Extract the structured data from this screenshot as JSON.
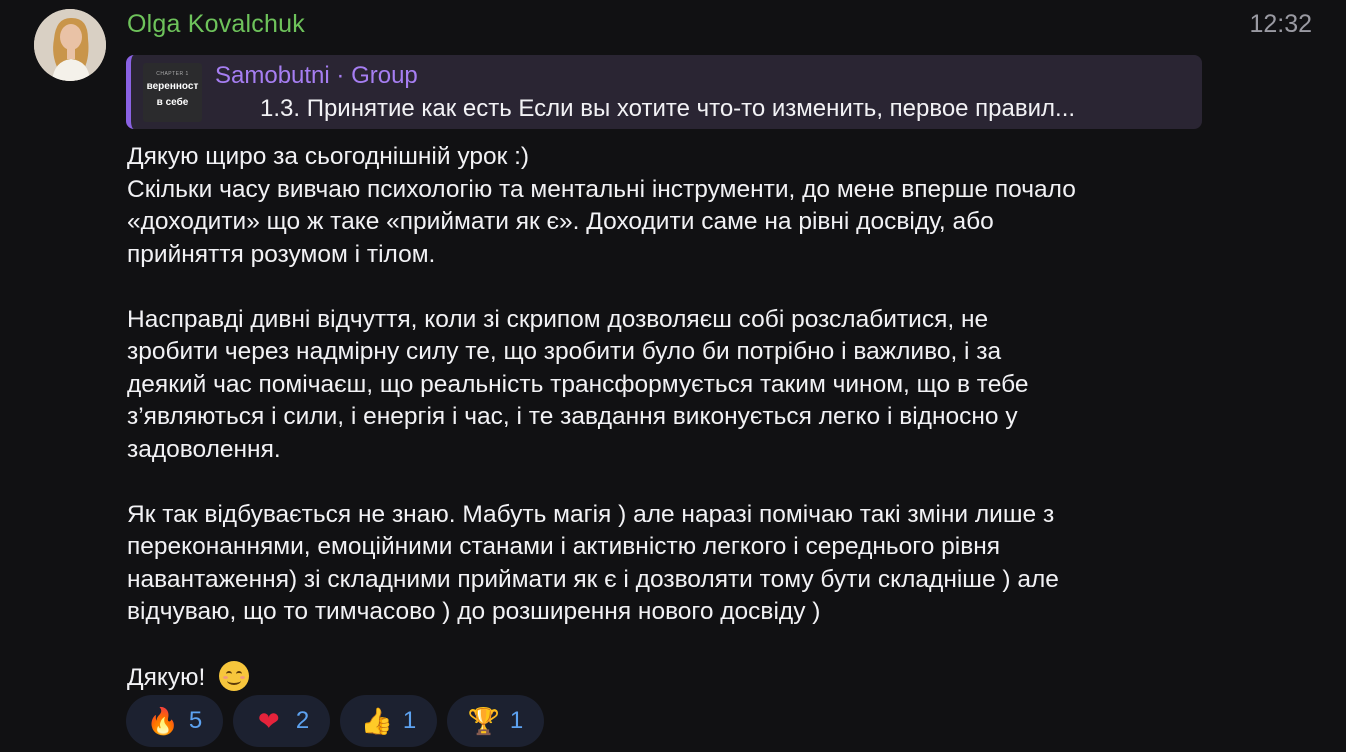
{
  "message": {
    "sender": "Olga Kovalchuk",
    "time": "12:32",
    "reply": {
      "title": "Samobutni · Group",
      "text": "1.3. Принятие как есть  Если вы хотите что-то изменить, первое правил...",
      "thumb_small": "CHAPTER 1",
      "thumb_line1": "веренност",
      "thumb_line2": "в себе"
    },
    "paragraph1": [
      "Дякую щиро за сьогоднішній урок :)",
      "Скільки часу вивчаю психологію та ментальні інструменти, до мене вперше почало",
      "«доходити» що ж таке «приймати як є». Доходити саме на рівні досвіду, або",
      "прийняття розумом і тілом."
    ],
    "paragraph2": [
      "Насправді дивні відчуття, коли зі скрипом дозволяєш собі розслабитися, не",
      "зробити через надмірну силу те, що зробити було би потрібно і важливо, і за",
      "деякий час помічаєш, що реальність трансформується таким чином, що в тебе",
      "з’являються і сили, і енергія і час, і те завдання виконується легко і відносно у",
      "задоволення."
    ],
    "paragraph3": [
      "Як так відбувається не знаю. Мабуть магія ) але наразі помічаю такі зміни лише з",
      "переконаннями, емоційними станами і активністю легкого і середнього рівня",
      "навантаження) зі складними приймати як є і дозволяти тому бути складніше ) але",
      "відчуваю, що то тимчасово ) до розширення нового досвіду )"
    ],
    "closing": "Дякую!",
    "closing_emoji": "smiling-face-emoji"
  },
  "reactions": [
    {
      "icon": "fire-emoji",
      "glyph": "🔥",
      "count": "5"
    },
    {
      "icon": "red-heart-emoji",
      "glyph": "❤",
      "count": "2"
    },
    {
      "icon": "thumbs-up-emoji",
      "glyph": "👍",
      "count": "1"
    },
    {
      "icon": "trophy-emoji",
      "glyph": "🏆",
      "count": "1"
    }
  ],
  "colors": {
    "background": "#111113",
    "sender": "#6ec35b",
    "reply_accent": "#8a62e3",
    "reaction_count": "#5da2f0"
  }
}
